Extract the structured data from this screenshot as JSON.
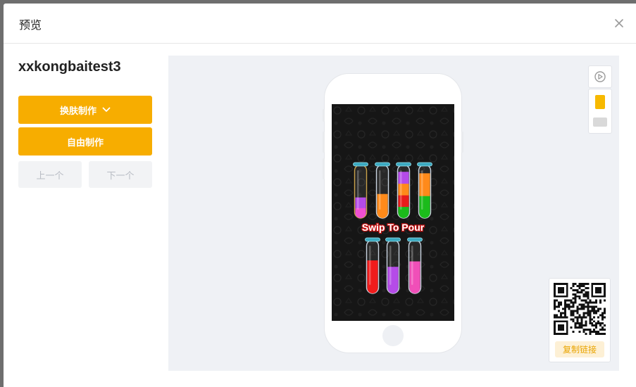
{
  "modal": {
    "title": "预览",
    "close_label": "×"
  },
  "project": {
    "name": "xxkongbaitest3"
  },
  "actions": {
    "skin_label": "换肤制作",
    "free_label": "自由制作",
    "prev_label": "上一个",
    "next_label": "下一个"
  },
  "game": {
    "caption": "Swip To Pour",
    "tubes_top": [
      {
        "layers": [
          "#f04fd2",
          "#b54be8"
        ],
        "fill": 0.42,
        "selected": true
      },
      {
        "layers": [
          "#ff8a1a"
        ],
        "fill": 0.49
      },
      {
        "layers": [
          "#1bbb1b",
          "#e81b1b",
          "#ff8a1a",
          "#b54be8"
        ],
        "fill": 0.94
      },
      {
        "layers": [
          "#1bbb1b",
          "#ff8a1a"
        ],
        "fill": 0.91
      }
    ],
    "tubes_bottom": [
      {
        "layers": [
          "#f01c1c"
        ],
        "fill": 0.67
      },
      {
        "layers": [
          "#b54be8"
        ],
        "fill": 0.54
      },
      {
        "layers": [
          "#f04fb8"
        ],
        "fill": 0.65
      }
    ]
  },
  "share": {
    "copy_label": "复制链接"
  },
  "colors": {
    "accent": "#f7ad00",
    "preview_bg": "#eff1f5",
    "disabled_bg": "#f2f3f5",
    "disabled_text": "#b8bcc4"
  }
}
